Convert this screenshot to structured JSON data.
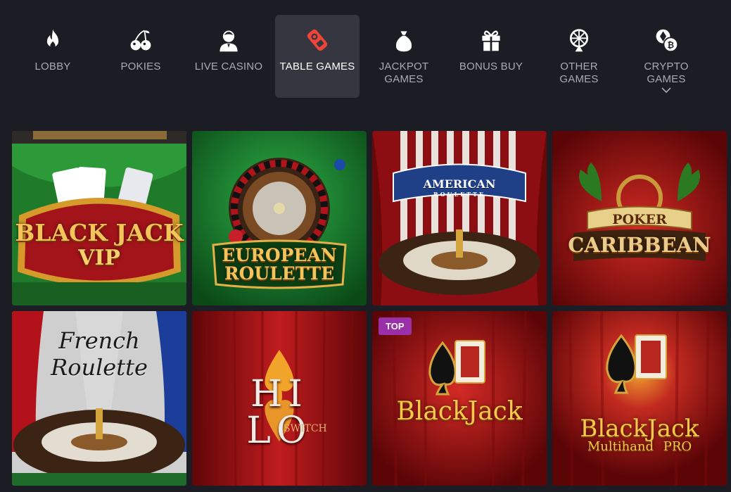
{
  "nav": {
    "items": [
      {
        "label": "LOBBY",
        "icon": "flame-icon"
      },
      {
        "label": "POKIES",
        "icon": "cherries-icon"
      },
      {
        "label": "LIVE CASINO",
        "icon": "dealer-icon"
      },
      {
        "label": "TABLE GAMES",
        "icon": "table-games-icon",
        "active": true
      },
      {
        "label": "JACKPOT\nGAMES",
        "icon": "money-bag-icon"
      },
      {
        "label": "BONUS BUY",
        "icon": "gift-icon"
      },
      {
        "label": "OTHER\nGAMES",
        "icon": "wheel-icon"
      },
      {
        "label": "CRYPTO\nGAMES",
        "icon": "crypto-coins-icon",
        "dropdown": true
      }
    ],
    "active_color": "#35363f"
  },
  "games": [
    {
      "title_line1": "BLACK JACK",
      "title_line2": "VIP"
    },
    {
      "title_line1": "EUROPEAN",
      "title_line2": "ROULETTE"
    },
    {
      "title_line1": "AMERICAN",
      "title_line2": "ROULETTE"
    },
    {
      "title_line1": "POKER",
      "title_line2": "CARIBBEAN"
    },
    {
      "title_line1": "French",
      "title_line2": "Roulette"
    },
    {
      "title_line1": "HI LO",
      "title_line2": "SWITCH"
    },
    {
      "title_line1": "BlackJack",
      "title_line2": "",
      "badge": "TOP"
    },
    {
      "title_line1": "BlackJack",
      "title_line2": "Multihand PRO"
    }
  ],
  "colors": {
    "background": "#1c1d24",
    "gold": "#f2c45a",
    "curtain_red": "#a5161a",
    "felt_green": "#1f7a2a",
    "badge_purple": "#9a2fa8"
  }
}
